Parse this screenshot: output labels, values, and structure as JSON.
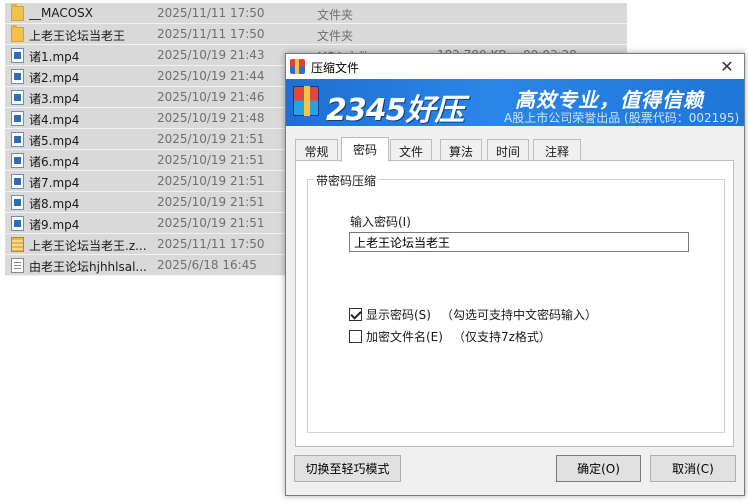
{
  "files": [
    {
      "name": "__MACOSX",
      "date": "2025/11/11 17:50",
      "type": "文件夹",
      "icon": "folder-icon"
    },
    {
      "name": "上老王论坛当老王",
      "date": "2025/11/11 17:50",
      "type": "文件夹",
      "icon": "folder-icon"
    },
    {
      "name": "诸1.mp4",
      "date": "2025/10/19 21:43",
      "type": "MP4 文件",
      "size": "182,790 KB",
      "duration": "00:03:28",
      "icon": "video-file-icon"
    },
    {
      "name": "诸2.mp4",
      "date": "2025/10/19 21:44",
      "icon": "video-file-icon"
    },
    {
      "name": "诸3.mp4",
      "date": "2025/10/19 21:46",
      "icon": "video-file-icon"
    },
    {
      "name": "诸4.mp4",
      "date": "2025/10/19 21:48",
      "icon": "video-file-icon"
    },
    {
      "name": "诸5.mp4",
      "date": "2025/10/19 21:51",
      "icon": "video-file-icon"
    },
    {
      "name": "诸6.mp4",
      "date": "2025/10/19 21:51",
      "icon": "video-file-icon"
    },
    {
      "name": "诸7.mp4",
      "date": "2025/10/19 21:51",
      "icon": "video-file-icon"
    },
    {
      "name": "诸8.mp4",
      "date": "2025/10/19 21:51",
      "icon": "video-file-icon"
    },
    {
      "name": "诸9.mp4",
      "date": "2025/10/19 21:51",
      "icon": "video-file-icon"
    },
    {
      "name": "上老王论坛当老王.z...",
      "date": "2025/11/11 17:50",
      "icon": "zip-file-icon"
    },
    {
      "name": "由老王论坛hjhhlsal...",
      "date": "2025/6/18 16:45",
      "icon": "text-file-icon"
    }
  ],
  "dialog": {
    "title": "压缩文件",
    "close_label": "✕",
    "banner": {
      "brand": "2345好压",
      "slogan": "高效专业，值得信赖",
      "subline": "A股上市公司荣誉出品 (股票代码：002195)"
    },
    "tabs": [
      {
        "label": "常规",
        "active": false
      },
      {
        "label": "密码",
        "active": true
      },
      {
        "label": "文件",
        "active": false
      },
      {
        "label": "算法",
        "active": false
      },
      {
        "label": "时间",
        "active": false
      },
      {
        "label": "注释",
        "active": false
      }
    ],
    "group_title": "带密码压缩",
    "password_label": "输入密码(I)",
    "password_value": "上老王论坛当老王",
    "show_password": {
      "label": "显示密码(S)",
      "hint": "（勾选可支持中文密码输入）",
      "checked": true
    },
    "encrypt_names": {
      "label": "加密文件名(E)",
      "hint": "（仅支持7z格式）",
      "checked": false
    },
    "buttons": {
      "switch_mode": "切换至轻巧模式",
      "ok": "确定(O)",
      "cancel": "取消(C)"
    }
  },
  "colors": {
    "banner_blue": "#1f6fd0",
    "list_selection": "#d9d9d9"
  }
}
